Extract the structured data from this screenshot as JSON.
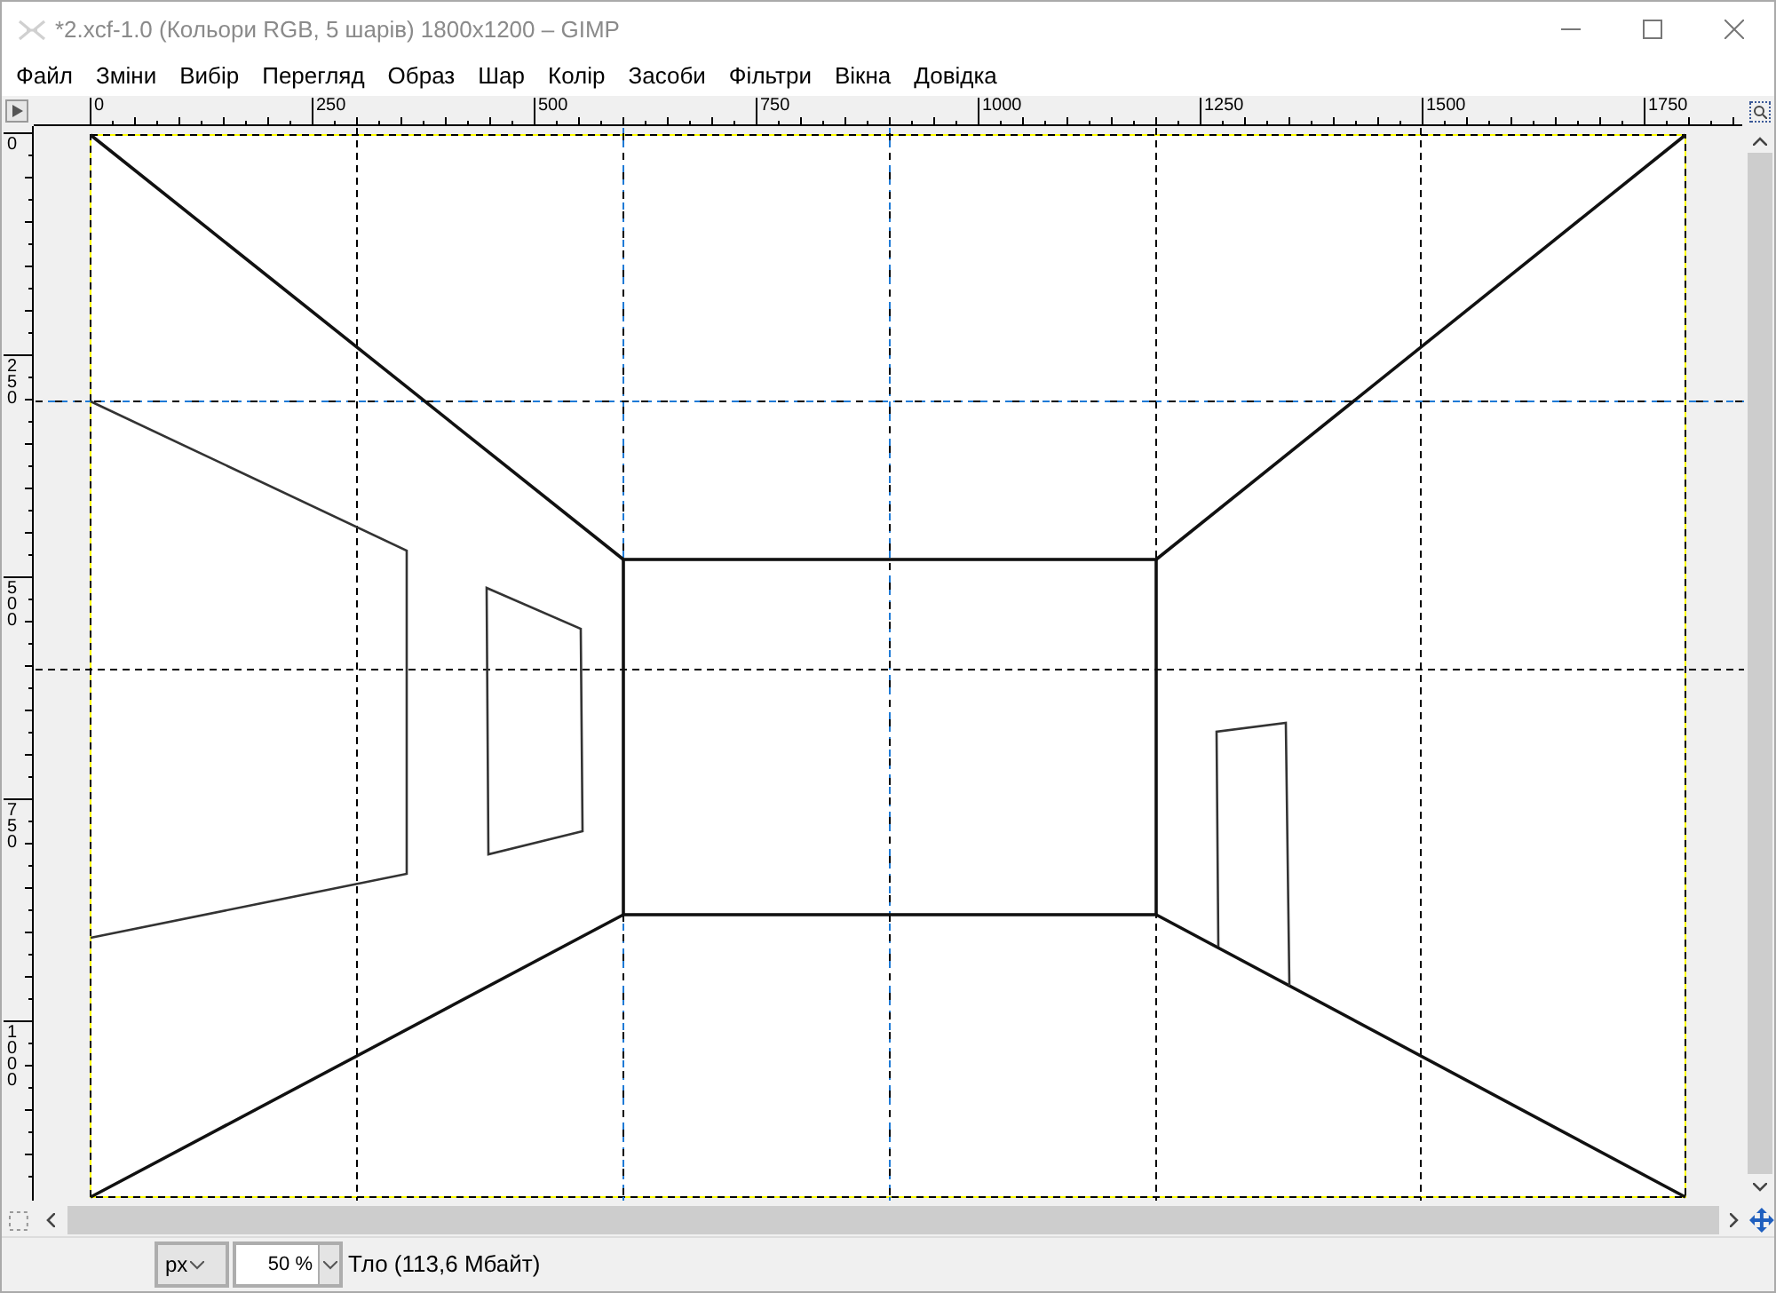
{
  "window": {
    "title": "*2.xcf-1.0 (Кольори RGB, 5 шарів) 1800x1200 – GIMP"
  },
  "menu": [
    {
      "label": "Файл"
    },
    {
      "label": "Зміни"
    },
    {
      "label": "Вибір"
    },
    {
      "label": "Перегляд"
    },
    {
      "label": "Образ"
    },
    {
      "label": "Шар"
    },
    {
      "label": "Колір"
    },
    {
      "label": "Засоби"
    },
    {
      "label": "Фільтри"
    },
    {
      "label": "Вікна"
    },
    {
      "label": "Довідка"
    }
  ],
  "rulers": {
    "horizontal": [
      "0",
      "250",
      "500",
      "750",
      "1000",
      "1250",
      "1500",
      "1750"
    ],
    "vertical": [
      "0",
      "250",
      "500",
      "750",
      "1000"
    ]
  },
  "status_bar": {
    "unit": "px",
    "zoom": "50 %",
    "layer_info": "Тло (113,6 Мбайт)"
  }
}
